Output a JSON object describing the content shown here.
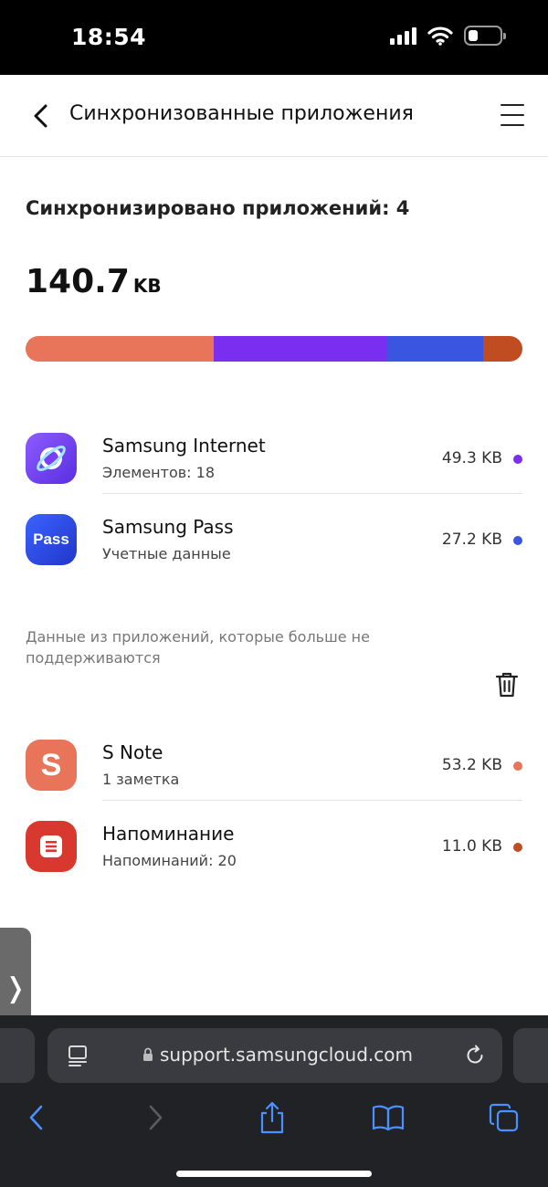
{
  "status_bar": {
    "time": "18:54"
  },
  "header": {
    "title": "Синхронизованные приложения"
  },
  "summary": {
    "title": "Синхронизировано приложений: 4",
    "total_value": "140.7",
    "total_unit": "KB"
  },
  "usage_bar": [
    {
      "app": "S Note",
      "value_kb": 53.2,
      "color": "#E8745A"
    },
    {
      "app": "Samsung Internet",
      "value_kb": 49.3,
      "color": "#7A2EF0"
    },
    {
      "app": "Samsung Pass",
      "value_kb": 27.2,
      "color": "#3A55E0"
    },
    {
      "app": "Напоминание",
      "value_kb": 11.0,
      "color": "#C04D21"
    }
  ],
  "synced_apps": [
    {
      "name": "Samsung Internet",
      "sub": "Элементов: 18",
      "size": "49.3 KB",
      "color": "#7A2EF0",
      "icon": "samsung-internet-icon"
    },
    {
      "name": "Samsung Pass",
      "sub": "Учетные данные",
      "size": "27.2 KB",
      "color": "#3A55E0",
      "icon": "samsung-pass-icon",
      "icon_text": "Pass"
    }
  ],
  "unsupported": {
    "text": "Данные из приложений, которые больше не поддерживаются",
    "apps": [
      {
        "name": "S Note",
        "sub": "1 заметка",
        "size": "53.2 KB",
        "color": "#E8745A",
        "icon": "s-note-icon"
      },
      {
        "name": "Напоминание",
        "sub": "Напоминаний: 20",
        "size": "11.0 KB",
        "color": "#C04D21",
        "icon": "reminder-icon"
      }
    ]
  },
  "browser": {
    "url": "support.samsungcloud.com"
  }
}
